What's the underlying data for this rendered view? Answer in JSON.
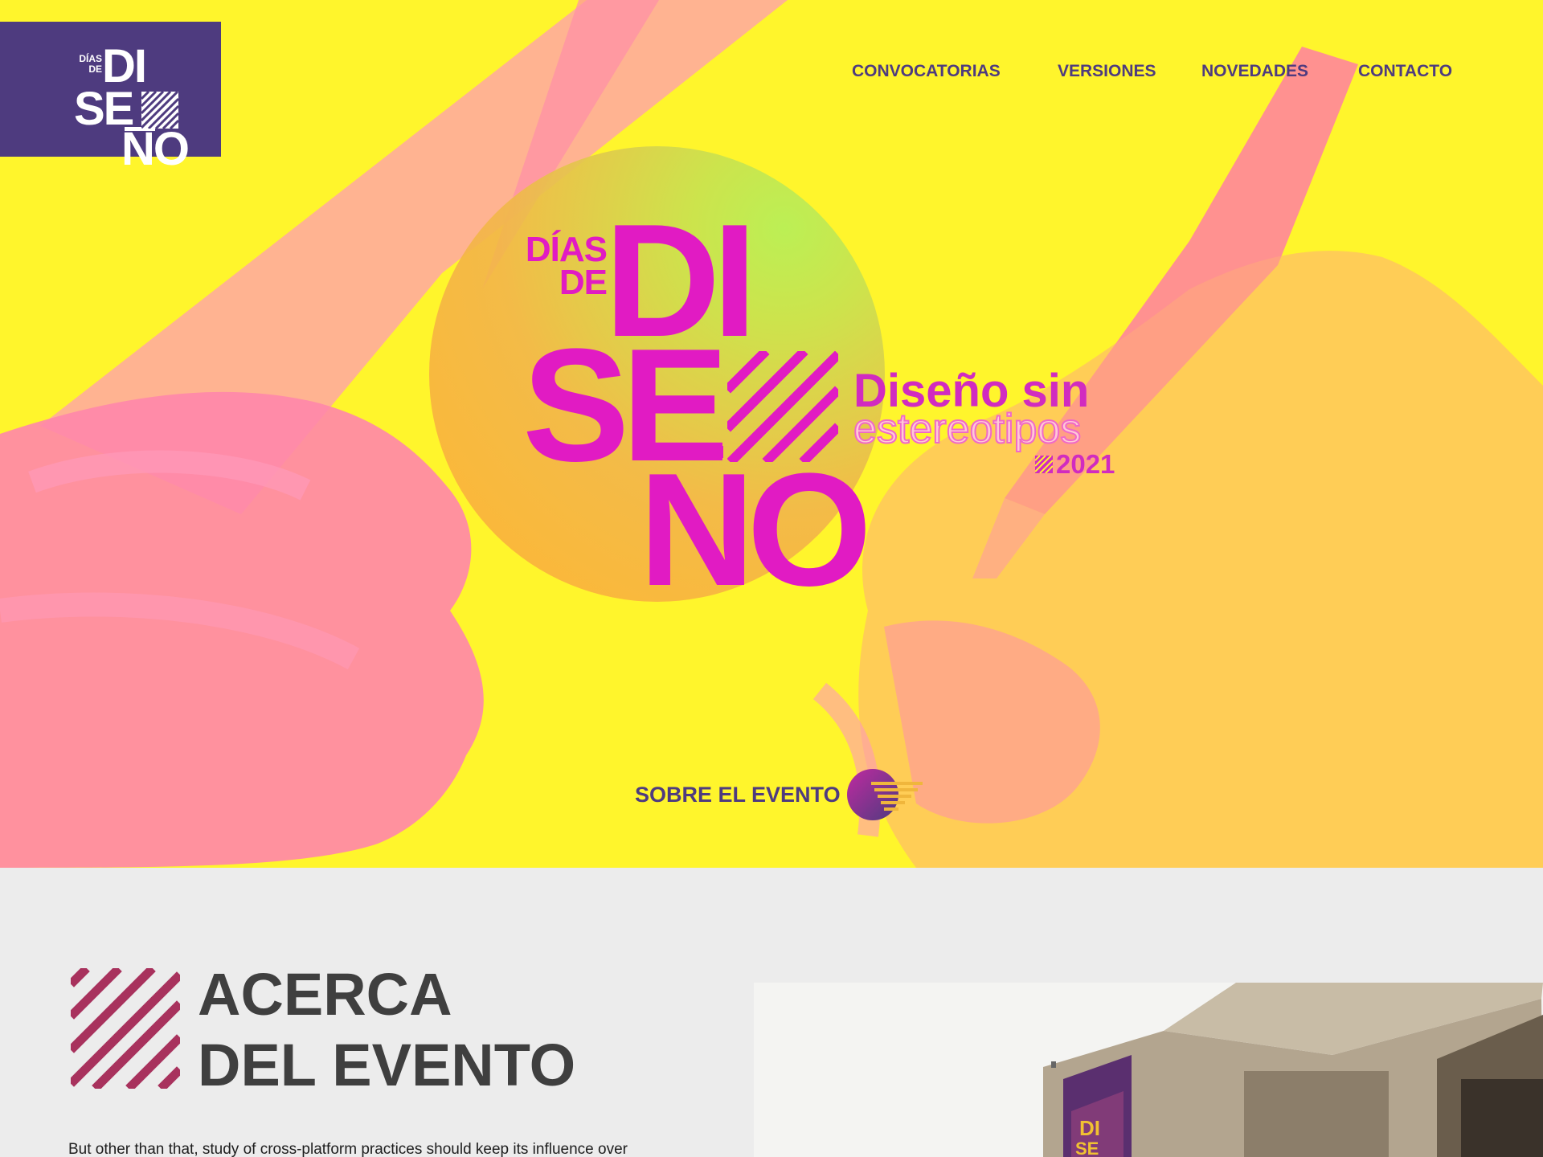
{
  "brand": {
    "logo_line1": "DÍAS",
    "logo_line2": "DE",
    "logo_di": "DI",
    "logo_se": "SE",
    "logo_no": "NO",
    "colors": {
      "purple": "#4e3b7f",
      "magenta": "#e11bc3",
      "yellow": "#fff52c",
      "pink": "#ff7fb0"
    }
  },
  "nav": {
    "items": [
      {
        "label": "CONVOCATORIAS"
      },
      {
        "label": "VERSIONES"
      },
      {
        "label": "NOVEDADES"
      },
      {
        "label": "CONTACTO"
      }
    ]
  },
  "hero": {
    "logo_dias": "DÍAS",
    "logo_de": "DE",
    "logo_di": "DI",
    "logo_se": "SE",
    "logo_no": "NO",
    "tagline_line1": "Diseño sin",
    "tagline_line2": "estereotipos",
    "year": "2021",
    "cta_label": "SOBRE EL EVENTO",
    "cta_icon": "arrow-circle-icon"
  },
  "about": {
    "title_line1": "ACERCA",
    "title_line2": "DEL EVENTO",
    "body": "But other than that, study of cross-platform practices should keep its influence over",
    "decor_icon": "diagonal-stripes-icon"
  }
}
